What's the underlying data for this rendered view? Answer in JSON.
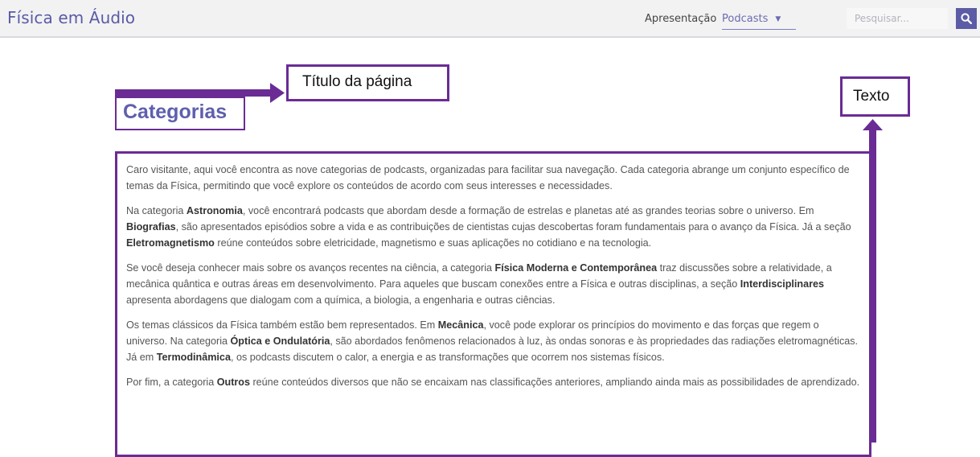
{
  "header": {
    "brand": "Física em Áudio",
    "nav": {
      "apresentacao": "Apresentação",
      "podcasts": "Podcasts"
    },
    "search": {
      "placeholder": "Pesquisar..."
    }
  },
  "callouts": {
    "title": "Título da página",
    "text": "Texto"
  },
  "page": {
    "title": "Categorias",
    "paragraphs": [
      [
        {
          "t": "Caro visitante, aqui você encontra as nove categorias de podcasts, organizadas para facilitar sua navegação. Cada categoria abrange um conjunto específico de temas da Física, permitindo que você explore os conteúdos de acordo com seus interesses e necessidades."
        }
      ],
      [
        {
          "t": "Na categoria "
        },
        {
          "t": "Astronomia",
          "b": true
        },
        {
          "t": ", você encontrará podcasts que abordam desde a formação de estrelas e planetas até as grandes teorias sobre o universo. Em "
        },
        {
          "t": "Biografias",
          "b": true
        },
        {
          "t": ", são apresentados episódios sobre a vida e as contribuições de cientistas cujas descobertas foram fundamentais para o avanço da Física. Já a seção "
        },
        {
          "t": "Eletromagnetismo",
          "b": true
        },
        {
          "t": " reúne conteúdos sobre eletricidade, magnetismo e suas aplicações no cotidiano e na tecnologia."
        }
      ],
      [
        {
          "t": "Se você deseja conhecer mais sobre os avanços recentes na ciência, a categoria "
        },
        {
          "t": "Física Moderna e Contemporânea",
          "b": true
        },
        {
          "t": " traz discussões sobre a relatividade, a mecânica quântica e outras áreas em desenvolvimento. Para aqueles que buscam conexões entre a Física e outras disciplinas, a seção "
        },
        {
          "t": "Interdisciplinares",
          "b": true
        },
        {
          "t": " apresenta abordagens que dialogam com a química, a biologia, a engenharia e outras ciências."
        }
      ],
      [
        {
          "t": "Os temas clássicos da Física também estão bem representados. Em "
        },
        {
          "t": "Mecânica",
          "b": true
        },
        {
          "t": ", você pode explorar os princípios do movimento e das forças que regem o universo. Na categoria "
        },
        {
          "t": "Óptica e Ondulatória",
          "b": true
        },
        {
          "t": ", são abordados fenômenos relacionados à luz, às ondas sonoras e às propriedades das radiações eletromagnéticas. Já em "
        },
        {
          "t": "Termodinâmica",
          "b": true
        },
        {
          "t": ", os podcasts discutem o calor, a energia e as transformações que ocorrem nos sistemas físicos."
        }
      ],
      [
        {
          "t": "Por fim, a categoria "
        },
        {
          "t": "Outros",
          "b": true
        },
        {
          "t": " reúne conteúdos diversos que não se encaixam nas classificações anteriores, ampliando ainda mais as possibilidades de aprendizado."
        }
      ]
    ]
  },
  "colors": {
    "accent": "#5f5fae",
    "annotation": "#6a2c94",
    "navbar_bg": "#f2f2f2"
  },
  "icons": {
    "search": "search-icon",
    "dropdown": "chevron-down-icon"
  }
}
